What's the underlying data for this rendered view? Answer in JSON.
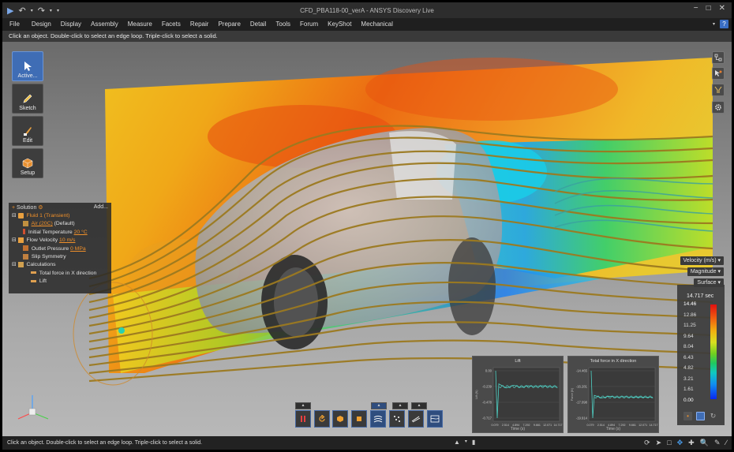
{
  "window": {
    "title": "CFD_PBA118-00_verA - ANSYS Discovery Live",
    "controls": [
      "−",
      "□",
      "✕"
    ]
  },
  "menu": {
    "items": [
      "File",
      "Design",
      "Display",
      "Assembly",
      "Measure",
      "Facets",
      "Repair",
      "Prepare",
      "Detail",
      "Tools",
      "Forum",
      "KeyShot",
      "Mechanical"
    ],
    "help": "?"
  },
  "hint": "Click an object. Double-click to select an edge loop. Triple-click to select a solid.",
  "tools": [
    {
      "label": "Active...",
      "icon": "cursor-icon",
      "active": true
    },
    {
      "label": "Sketch",
      "icon": "pencil-icon",
      "active": false
    },
    {
      "label": "Edit",
      "icon": "edit-brush-icon",
      "active": false
    },
    {
      "label": "Setup",
      "icon": "setup-cube-icon",
      "active": false
    }
  ],
  "solution": {
    "header": "Solution",
    "add": "Add...",
    "fluid": "Fluid 1 (Transient)",
    "air_link": "Air (20C)",
    "air_default": "(Default)",
    "initial_temp_label": "Initial Temperature",
    "initial_temp_value": "20 °C",
    "flow_velocity_label": "Flow Velocity",
    "flow_velocity_value": "10 m/s",
    "outlet_pressure_label": "Outlet Pressure",
    "outlet_pressure_value": "0 MPa",
    "slip_symmetry": "Slip Symmetry",
    "calculations": "Calculations",
    "total_force": "Total force in X direction",
    "lift": "Lift"
  },
  "legend": {
    "quantity": "Velocity (m/s)",
    "component": "Magnitude",
    "display": "Surface",
    "time": "14.717 sec",
    "ticks": [
      "14.46",
      "12.86",
      "11.25",
      "9.64",
      "8.04",
      "6.43",
      "4.82",
      "3.21",
      "1.61",
      "0.00"
    ]
  },
  "chart_data": [
    {
      "type": "line",
      "title": "Lift",
      "xlabel": "Time (s)",
      "ylabel": "Lift (N)",
      "y_ticks": [
        "0.00",
        "-0.239",
        "-0.478",
        "-0.717"
      ],
      "x_ticks": [
        "0.079",
        "2.514",
        "4.894",
        "7.292",
        "9.661",
        "12.071",
        "14.717"
      ],
      "series": [
        {
          "values": [
            0.0,
            -0.717,
            -0.2,
            -0.26,
            -0.22,
            -0.25,
            -0.23,
            -0.24,
            -0.23,
            -0.24,
            -0.24
          ]
        }
      ]
    },
    {
      "type": "line",
      "title": "Total force in X direction",
      "xlabel": "Time (s)",
      "ylabel": "Force (N)",
      "y_ticks": [
        "-14.465",
        "-16.281",
        "-17.098",
        "-19.914"
      ],
      "x_ticks": [
        "0.079",
        "2.514",
        "4.894",
        "7.292",
        "9.661",
        "12.071",
        "14.717"
      ],
      "series": [
        {
          "values": [
            -14.465,
            -19.914,
            -17.3,
            -17.6,
            -17.4,
            -17.5,
            -17.45,
            -17.5,
            -17.48,
            -17.5,
            -17.5
          ]
        }
      ]
    }
  ],
  "status": {
    "text": "Click an object. Double-click to select an edge loop. Triple-click to select a solid."
  },
  "colors": {
    "accent": "#3f6db5",
    "highlight": "#f0902a",
    "series_line": "#4fd1c5"
  }
}
